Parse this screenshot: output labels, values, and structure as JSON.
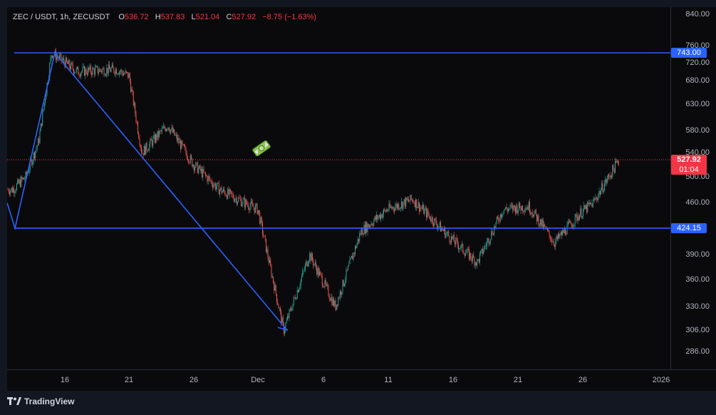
{
  "legend": {
    "symbol": "ZEC / USDT, 1h, ZECUSDT",
    "open_label": "O",
    "open": "536.72",
    "high_label": "H",
    "high": "537.83",
    "low_label": "L",
    "low": "521.04",
    "close_label": "C",
    "close": "527.92",
    "change": "−8.75 (−1.63%)"
  },
  "price_axis": [
    "840.00",
    "760.00",
    "720.00",
    "680.00",
    "630.00",
    "580.00",
    "540.00",
    "500.00",
    "460.00",
    "424.15",
    "390.00",
    "360.00",
    "330.00",
    "306.00",
    "286.00"
  ],
  "price_tags": {
    "upper_line": "743.00",
    "current_price": "527.92",
    "countdown": "01:04",
    "lower_line": "424.15"
  },
  "time_axis": [
    "16",
    "21",
    "26",
    "Dec",
    "6",
    "11",
    "16",
    "21",
    "26",
    "2026"
  ],
  "branding": {
    "name": "TradingView"
  },
  "colors": {
    "background": "#0a0a0c",
    "up": "#26a69a",
    "down": "#ef5350",
    "drawing": "#2962ff",
    "last_price": "#f23645"
  },
  "chart_data": {
    "type": "candlestick",
    "title": "ZEC / USDT, 1h, ZECUSDT",
    "x": [
      "16",
      "21",
      "26",
      "Dec",
      "6",
      "11",
      "16",
      "21",
      "26",
      "2026"
    ],
    "ylim": [
      270,
      860
    ],
    "y_scale": "log",
    "series": [
      {
        "values": [
          [
            "Nov 12",
            480
          ],
          [
            "Nov 13",
            500
          ],
          [
            "Nov 14",
            560
          ],
          [
            "Nov 15",
            743
          ],
          [
            "Nov 17",
            700
          ],
          [
            "Nov 20",
            705
          ],
          [
            "Nov 21",
            690
          ],
          [
            "Nov 22",
            540
          ],
          [
            "Nov 24",
            590
          ],
          [
            "Nov 26",
            520
          ],
          [
            "Nov 28",
            480
          ],
          [
            "Dec 1",
            450
          ],
          [
            "Dec 3",
            306
          ],
          [
            "Dec 5",
            390
          ],
          [
            "Dec 7",
            330
          ],
          [
            "Dec 9",
            420
          ],
          [
            "Dec 11",
            450
          ],
          [
            "Dec 13",
            465
          ],
          [
            "Dec 16",
            410
          ],
          [
            "Dec 18",
            380
          ],
          [
            "Dec 20",
            450
          ],
          [
            "Dec 22",
            455
          ],
          [
            "Dec 24",
            405
          ],
          [
            "Dec 26",
            445
          ],
          [
            "Dec 27",
            460
          ],
          [
            "Dec 29",
            527.92
          ]
        ]
      }
    ],
    "drawings": {
      "horizontal_lines": [
        743.0,
        424.15
      ],
      "trend_lines": [
        [
          [
            "Nov 11",
            460
          ],
          [
            "Nov 12",
            424
          ],
          [
            "Nov 15",
            743
          ],
          [
            "Dec 3",
            306
          ]
        ]
      ]
    }
  }
}
